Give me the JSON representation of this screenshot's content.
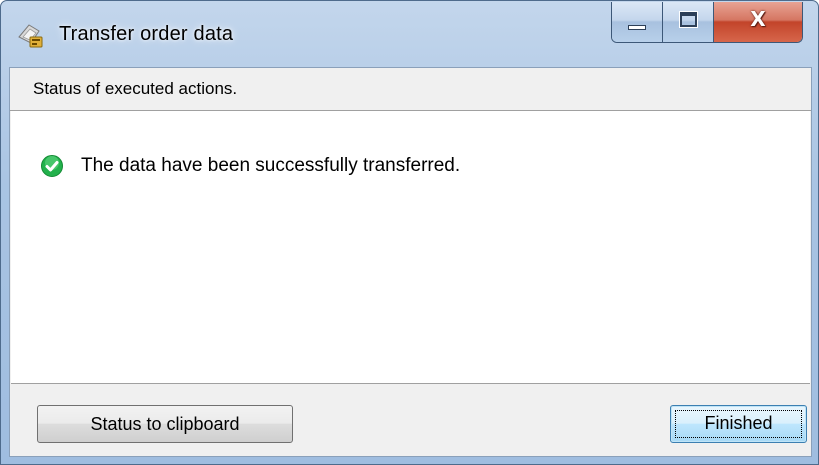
{
  "window": {
    "title": "Transfer order data",
    "icon": "transfer-icon",
    "caption_buttons": {
      "minimize_icon": "minimize-icon",
      "maximize_icon": "maximize-icon",
      "close_icon": "close-icon",
      "close_glyph": "X"
    }
  },
  "status": {
    "header": "Status of executed actions.",
    "messages": [
      {
        "icon": "success-check-icon",
        "text": "The data have been successfully transferred."
      }
    ]
  },
  "buttons": {
    "clipboard_label": "Status to clipboard",
    "finished_label": "Finished"
  },
  "colors": {
    "success": "#22b14c",
    "close_button": "#c2442a",
    "titlebar": "#a9c4e3"
  }
}
